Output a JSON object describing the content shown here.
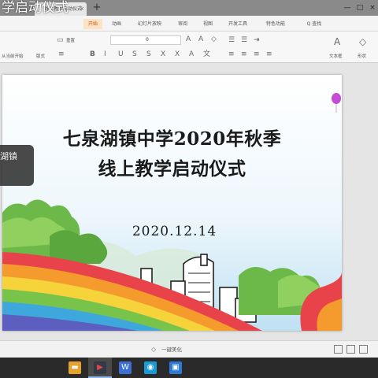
{
  "window": {
    "overlay_title": "学启动仪式",
    "doc_tab": "线上教学启动仪式",
    "tab_close": "×",
    "tab_add": "+",
    "controls": [
      "—",
      "□",
      "×"
    ]
  },
  "ribbon": {
    "menu": [
      "开始",
      "动画",
      "幻灯片放映",
      "审阅",
      "视图",
      "开发工具",
      "特色功能",
      "Q 查找"
    ],
    "active_menu": "开始",
    "toolbar": {
      "reset": "重置",
      "from_current": "从当前开始",
      "layout": "版式",
      "font_size": "0",
      "text_box": "文本框",
      "shape": "形状"
    }
  },
  "slide": {
    "title_line1": "七泉湖镇中学2020年秋季",
    "title_line2": "线上教学启动仪式",
    "date": "2020.12.14"
  },
  "popup": {
    "text": "湖镇"
  },
  "statusbar": {
    "beautify": "一键美化"
  },
  "colors": {
    "accent": "#c8561b",
    "taskbar": "#2a2a2a",
    "taskbar_icons": [
      "#e6a22c",
      "#303a48",
      "#3b6fd4",
      "#1a9bd7",
      "#2d7ad6"
    ]
  }
}
